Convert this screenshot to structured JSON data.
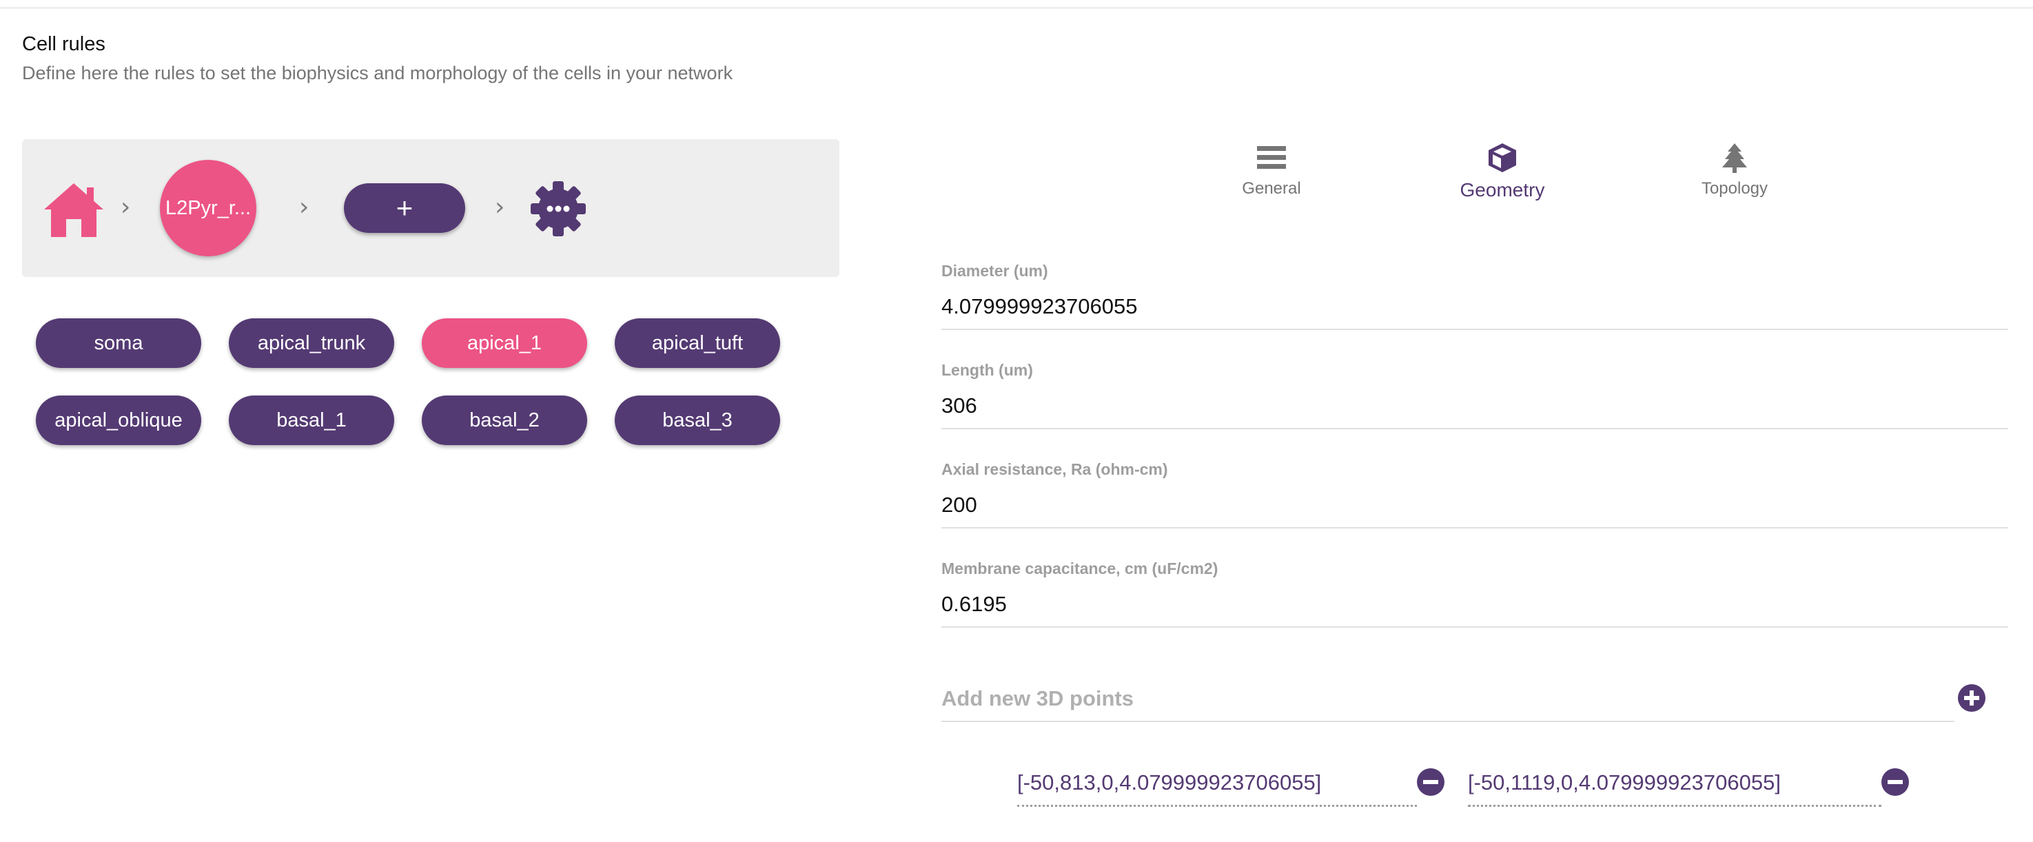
{
  "header": {
    "title": "Cell rules",
    "subtitle": "Define here the rules to set the biophysics and morphology of the cells in your network"
  },
  "breadcrumb": {
    "home_icon": "home-icon",
    "cell_rule_label": "L2Pyr_r...",
    "add_label": "+",
    "settings_icon": "gear-icon"
  },
  "sections": [
    "soma",
    "apical_trunk",
    "apical_1",
    "apical_tuft",
    "apical_oblique",
    "basal_1",
    "basal_2",
    "basal_3"
  ],
  "selected_section": "apical_1",
  "tabs": {
    "general": "General",
    "geometry": "Geometry",
    "topology": "Topology",
    "active": "Geometry"
  },
  "fields": {
    "diameter": {
      "label": "Diameter (um)",
      "value": "4.079999923706055"
    },
    "length": {
      "label": "Length (um)",
      "value": "306"
    },
    "ra": {
      "label": "Axial resistance, Ra (ohm-cm)",
      "value": "200"
    },
    "cm": {
      "label": "Membrane capacitance, cm (uF/cm2)",
      "value": "0.6195"
    }
  },
  "points3d": {
    "placeholder": "Add new 3D points",
    "items": [
      "[-50,813,0,4.079999923706055]",
      "[-50,1119,0,4.079999923706055]"
    ]
  },
  "colors": {
    "primary": "#543a73",
    "accent": "#ec5486",
    "muted": "#9e9e9e"
  }
}
